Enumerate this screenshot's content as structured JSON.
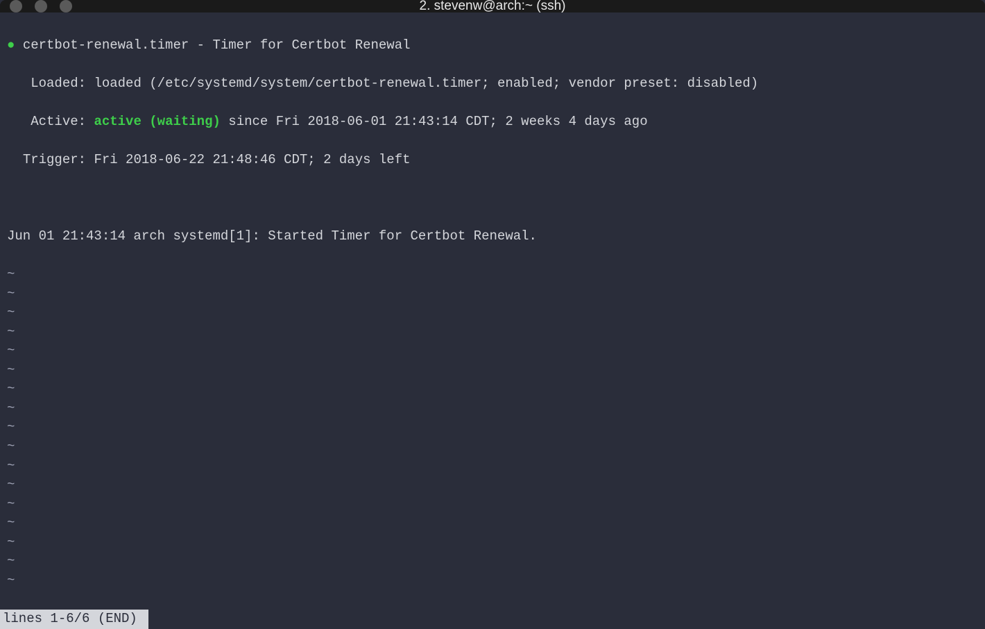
{
  "window": {
    "title": "2. stevenw@arch:~ (ssh)"
  },
  "terminal": {
    "unit_name": "certbot-renewal.timer - Timer for Certbot Renewal",
    "loaded_label": "Loaded:",
    "loaded_value": "loaded (/etc/systemd/system/certbot-renewal.timer; enabled; vendor preset: disabled)",
    "active_label": "Active:",
    "active_status": "active (waiting)",
    "active_since": "since Fri 2018-06-01 21:43:14 CDT; 2 weeks 4 days ago",
    "trigger_label": "Trigger:",
    "trigger_value": "Fri 2018-06-22 21:48:46 CDT; 2 days left",
    "log_line": "Jun 01 21:43:14 arch systemd[1]: Started Timer for Certbot Renewal.",
    "tilde": "~",
    "tilde_count": 17,
    "status_bar": "lines 1-6/6 (END)"
  },
  "colors": {
    "background": "#2a2d3a",
    "foreground": "#d4d6db",
    "green": "#3ece4a",
    "titlebar": "#1a1a1a"
  }
}
